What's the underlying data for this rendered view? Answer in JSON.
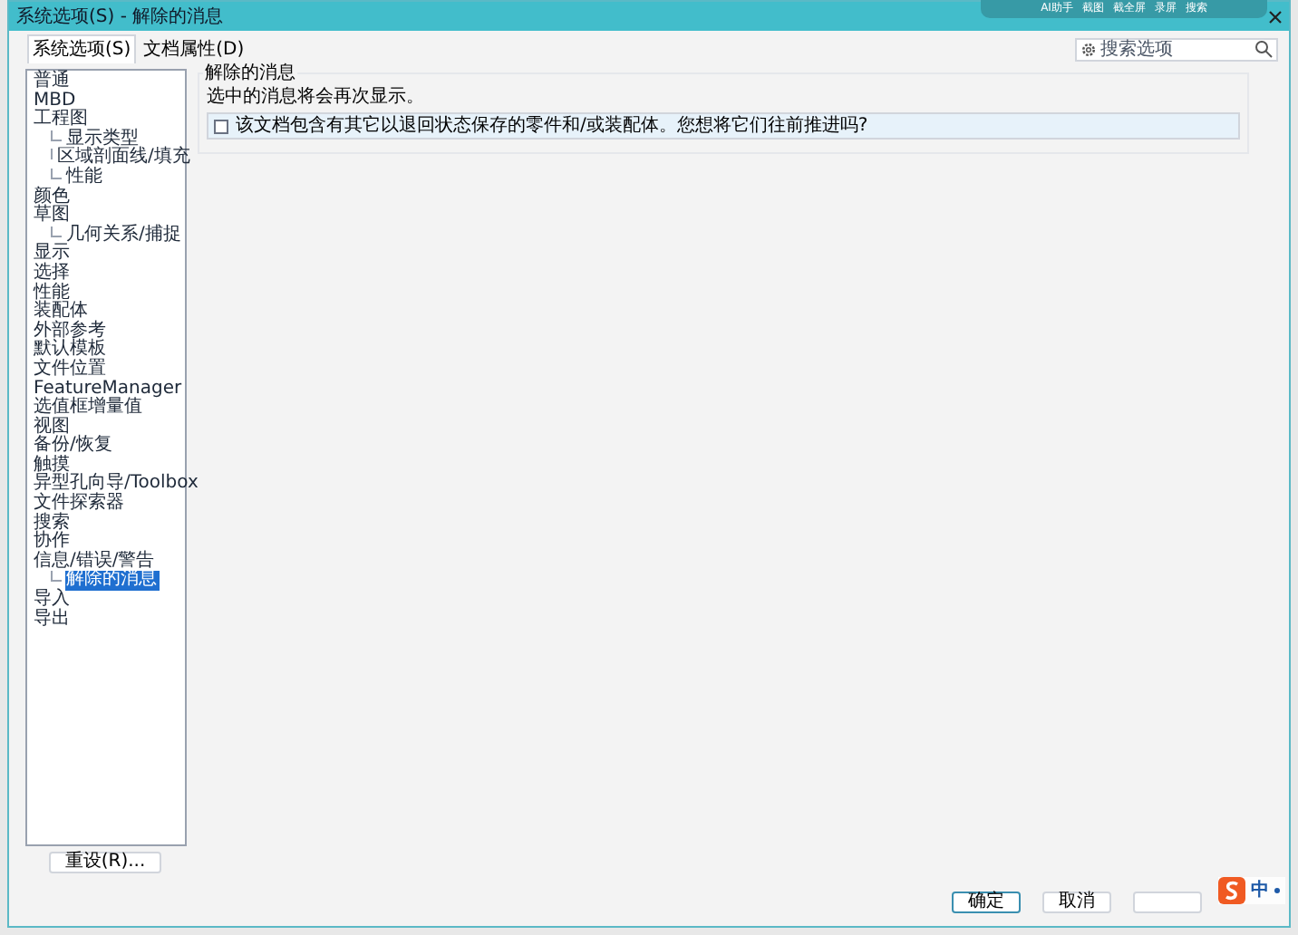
{
  "window": {
    "title": "系统选项(S) - 解除的消息"
  },
  "capture_toolbar": {
    "items": [
      "AI助手",
      "截图",
      "截全屏",
      "录屏",
      "搜索"
    ]
  },
  "tabs": [
    {
      "label": "系统选项(S)",
      "selected": true
    },
    {
      "label": "文档属性(D)",
      "selected": false
    }
  ],
  "search": {
    "placeholder": "搜索选项"
  },
  "sidebar": {
    "items": [
      {
        "label": "普通",
        "selected": false
      },
      {
        "label": "MBD",
        "selected": false
      },
      {
        "label": "工程图",
        "selected": false,
        "children": [
          {
            "label": "显示类型",
            "selected": false
          },
          {
            "label": "区域剖面线/填充",
            "selected": false
          },
          {
            "label": "性能",
            "selected": false
          }
        ]
      },
      {
        "label": "颜色",
        "selected": false
      },
      {
        "label": "草图",
        "selected": false,
        "children": [
          {
            "label": "几何关系/捕捉",
            "selected": false
          }
        ]
      },
      {
        "label": "显示",
        "selected": false
      },
      {
        "label": "选择",
        "selected": false
      },
      {
        "label": "性能",
        "selected": false
      },
      {
        "label": "装配体",
        "selected": false
      },
      {
        "label": "外部参考",
        "selected": false
      },
      {
        "label": "默认模板",
        "selected": false
      },
      {
        "label": "文件位置",
        "selected": false
      },
      {
        "label": "FeatureManager",
        "selected": false
      },
      {
        "label": "选值框增量值",
        "selected": false
      },
      {
        "label": "视图",
        "selected": false
      },
      {
        "label": "备份/恢复",
        "selected": false
      },
      {
        "label": "触摸",
        "selected": false
      },
      {
        "label": "异型孔向导/Toolbox",
        "selected": false
      },
      {
        "label": "文件探索器",
        "selected": false
      },
      {
        "label": "搜索",
        "selected": false
      },
      {
        "label": "协作",
        "selected": false
      },
      {
        "label": "信息/错误/警告",
        "selected": false,
        "children": [
          {
            "label": "解除的消息",
            "selected": true
          }
        ]
      },
      {
        "label": "导入",
        "selected": false
      },
      {
        "label": "导出",
        "selected": false
      }
    ]
  },
  "reset_button": "重设(R)...",
  "group": {
    "title": "解除的消息",
    "hint": "选中的消息将会再次显示。",
    "messages": [
      {
        "text": "该文档包含有其它以退回状态保存的零件和/或装配体。您想将它们往前推进吗?",
        "checked": false
      }
    ]
  },
  "buttons": [
    "确定",
    "取消"
  ],
  "ime": {
    "label": "中"
  }
}
